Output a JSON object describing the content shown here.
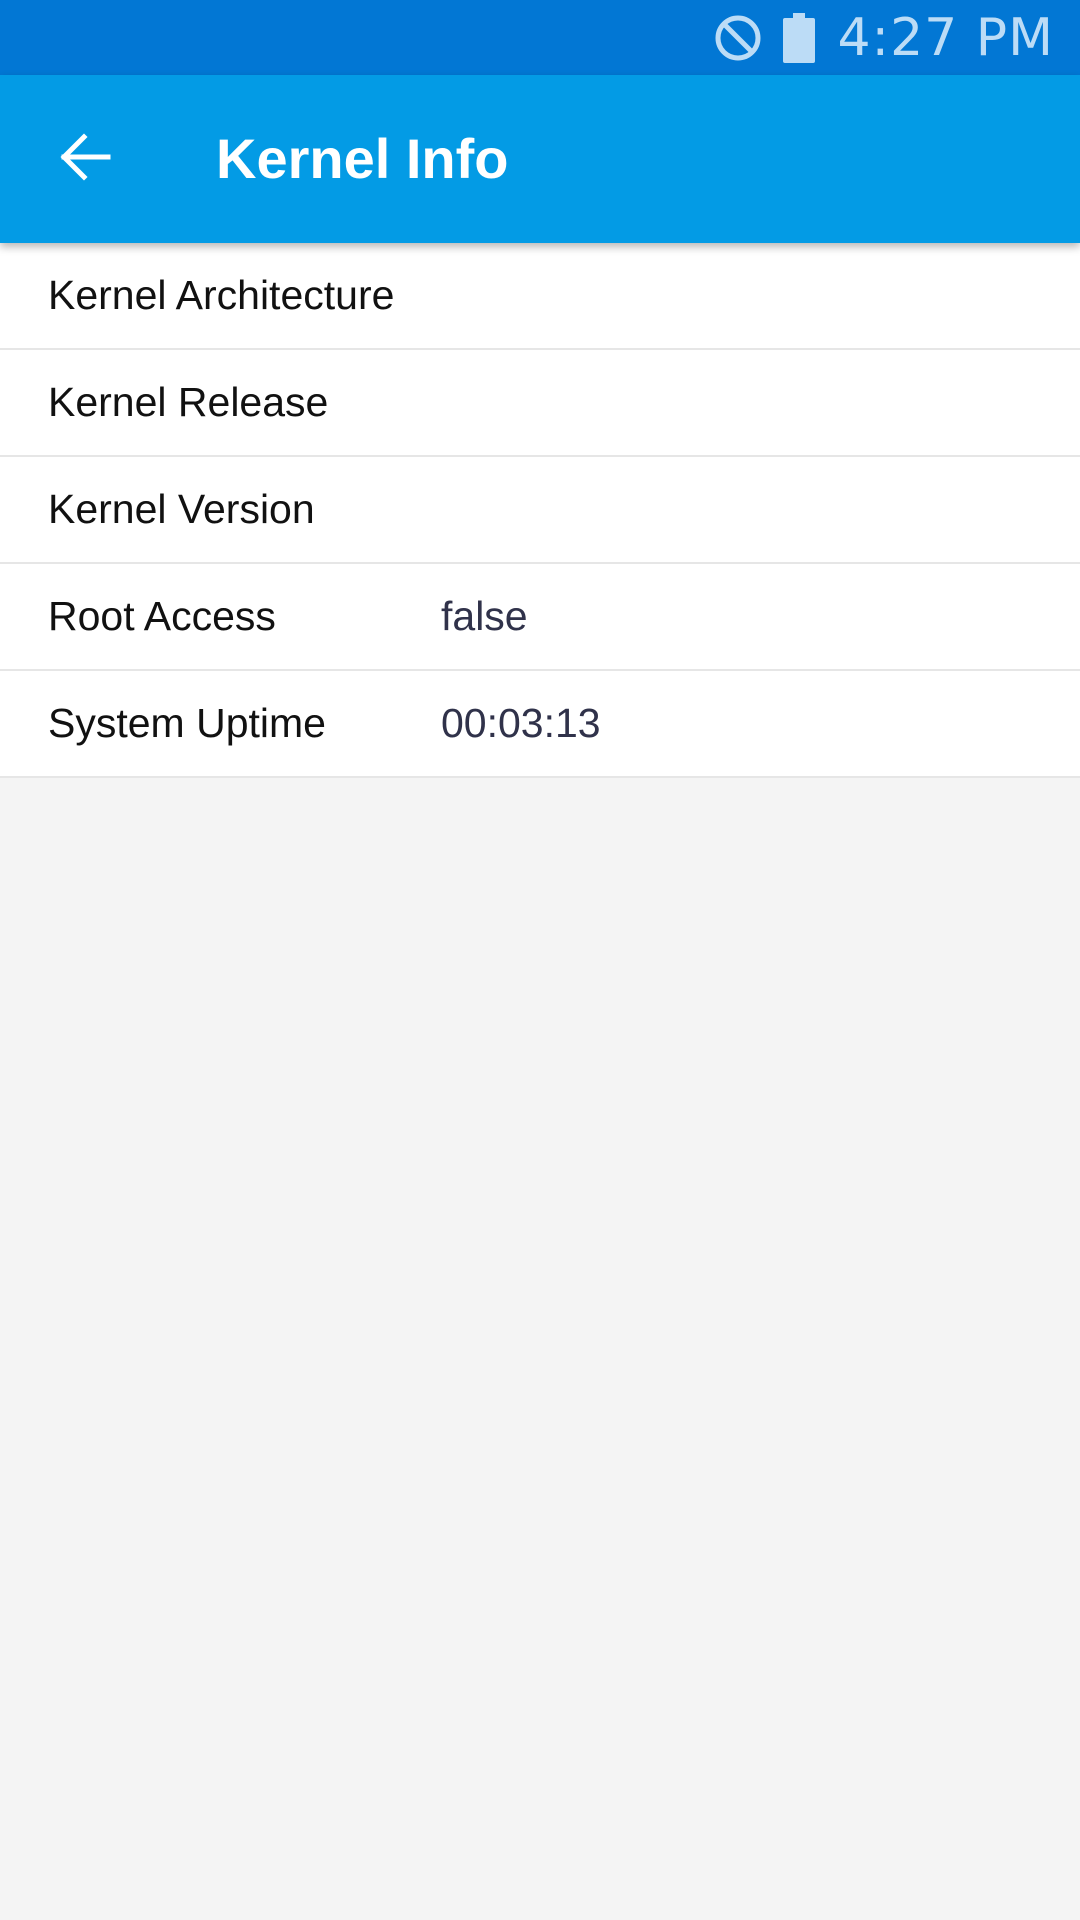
{
  "status_bar": {
    "time": "4:27 PM",
    "icons": [
      "do-not-disturb-icon",
      "battery-icon"
    ],
    "background_color": "#0277d4",
    "text_color": "#bcdcf6"
  },
  "app_bar": {
    "title": "Kernel Info",
    "back_icon": "arrow-back-icon",
    "background_color": "#039be5"
  },
  "rows": [
    {
      "label": "Kernel Architecture",
      "value": ""
    },
    {
      "label": "Kernel Release",
      "value": ""
    },
    {
      "label": "Kernel Version",
      "value": ""
    },
    {
      "label": "Root Access",
      "value": "false"
    },
    {
      "label": "System Uptime",
      "value": "00:03:13"
    }
  ],
  "colors": {
    "background": "#f4f4f4",
    "list_background": "#ffffff",
    "divider": "#e6e6e6",
    "label_text": "#111111",
    "value_text": "#30324a"
  }
}
